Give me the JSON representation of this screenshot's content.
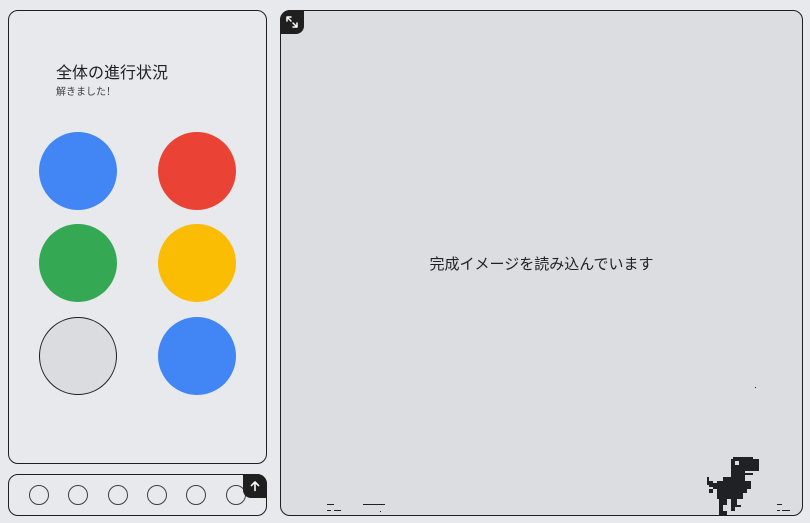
{
  "progress_panel": {
    "title": "全体の進行状況",
    "status": "解きました！",
    "circles": [
      {
        "state": "solved",
        "color": "#4285f4"
      },
      {
        "state": "solved",
        "color": "#ea4335"
      },
      {
        "state": "solved",
        "color": "#34a853"
      },
      {
        "state": "solved",
        "color": "#fbbc04"
      },
      {
        "state": "unsolved",
        "color": "#dadce0"
      },
      {
        "state": "solved",
        "color": "#4285f4"
      }
    ]
  },
  "navigation": {
    "dot_count": 6,
    "up_icon": "arrow-up-icon"
  },
  "main": {
    "expand_icon": "expand-icon",
    "loading_text": "完成イメージを読み込んでいます",
    "game_character": "dino-icon"
  },
  "colors": {
    "background": "#e8e9ed",
    "main_background": "#dcdde1",
    "border": "#1f1f1f"
  }
}
